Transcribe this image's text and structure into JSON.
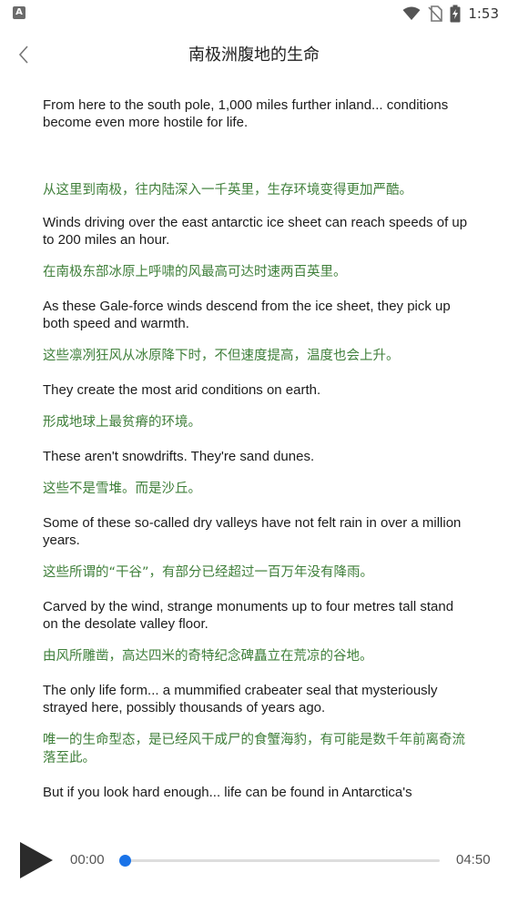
{
  "status_bar": {
    "left_icon": "notification-a-icon",
    "time": "1:53"
  },
  "header": {
    "back_icon": "chevron-left-icon",
    "title": "南极洲腹地的生命"
  },
  "transcript": [
    {
      "en": "From here to the south pole, 1,000 miles further inland... conditions become even more hostile for life.",
      "zh": "从这里到南极，往内陆深入一千英里，生存环境变得更加严酷。"
    },
    {
      "en": "Winds driving over the east antarctic ice sheet can reach speeds of up to 200 miles an hour.",
      "zh": "在南极东部冰原上呼啸的风最高可达时速两百英里。"
    },
    {
      "en": "As these Gale-force winds descend from the ice sheet, they pick up both speed and warmth.",
      "zh": "这些凛冽狂风从冰原降下时，不但速度提高，温度也会上升。"
    },
    {
      "en": "They create the most arid conditions on earth.",
      "zh": "形成地球上最贫瘠的环境。"
    },
    {
      "en": "These aren't snowdrifts. They're sand dunes.",
      "zh": "这些不是雪堆。而是沙丘。"
    },
    {
      "en": "Some of these so-called dry valleys have not felt rain in over a million years.",
      "zh": "这些所谓的“干谷”，有部分已经超过一百万年没有降雨。"
    },
    {
      "en": "Carved by the wind, strange monuments up to four metres tall stand on the desolate valley floor.",
      "zh": "由风所雕凿，高达四米的奇特纪念碑矗立在荒凉的谷地。"
    },
    {
      "en": "The only life form... a mummified crabeater seal that mysteriously strayed here, possibly thousands of years ago.",
      "zh": "唯一的生命型态，是已经风干成尸的食蟹海豹，有可能是数千年前离奇流落至此。"
    },
    {
      "en": "But if you look hard enough... life can be found in Antarctica's",
      "zh": ""
    }
  ],
  "player": {
    "play_icon": "play-icon",
    "current_time": "00:00",
    "total_time": "04:50",
    "progress": 0.0,
    "accent_color": "#1a73e8"
  }
}
